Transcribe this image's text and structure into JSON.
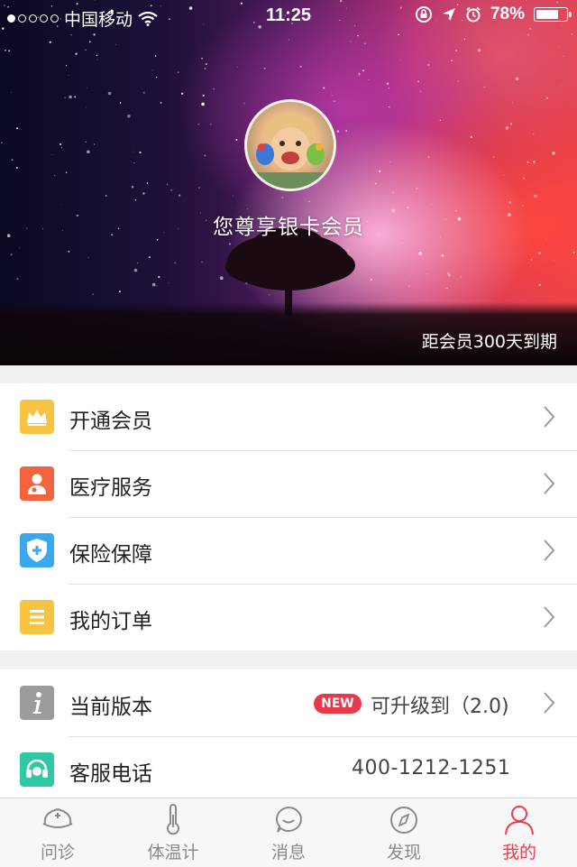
{
  "status_bar": {
    "carrier": "中国移动",
    "time": "11:25",
    "battery": "78%",
    "battery_level": 0.78,
    "signal_bars": 1
  },
  "profile": {
    "member_title": "您尊享银卡会员",
    "expiry_text": "距会员300天到期"
  },
  "menu_primary": [
    {
      "label": "开通会员",
      "icon": "crown-icon",
      "color": "#f6c342"
    },
    {
      "label": "医疗服务",
      "icon": "doctor-icon",
      "color": "#f2633f"
    },
    {
      "label": "保险保障",
      "icon": "shield-plus-icon",
      "color": "#3aa8ef"
    },
    {
      "label": "我的订单",
      "icon": "list-icon",
      "color": "#f6c342"
    }
  ],
  "menu_secondary": [
    {
      "label": "当前版本",
      "icon": "info-icon",
      "color": "#9b9b9b",
      "badge": "NEW",
      "value": "可升级到（2.0)"
    },
    {
      "label": "客服电话",
      "icon": "headset-icon",
      "color": "#2fc7a4",
      "value": "400-1212-1251"
    }
  ],
  "tabs": [
    {
      "label": "问诊",
      "icon": "nurse-cap-icon",
      "active": false
    },
    {
      "label": "体温计",
      "icon": "thermometer-icon",
      "active": false
    },
    {
      "label": "消息",
      "icon": "message-bubble-icon",
      "active": false
    },
    {
      "label": "发现",
      "icon": "compass-icon",
      "active": false
    },
    {
      "label": "我的",
      "icon": "person-icon",
      "active": true
    }
  ],
  "colors": {
    "accent": "#f03c4c",
    "tab_inactive": "#8a8a8e"
  }
}
